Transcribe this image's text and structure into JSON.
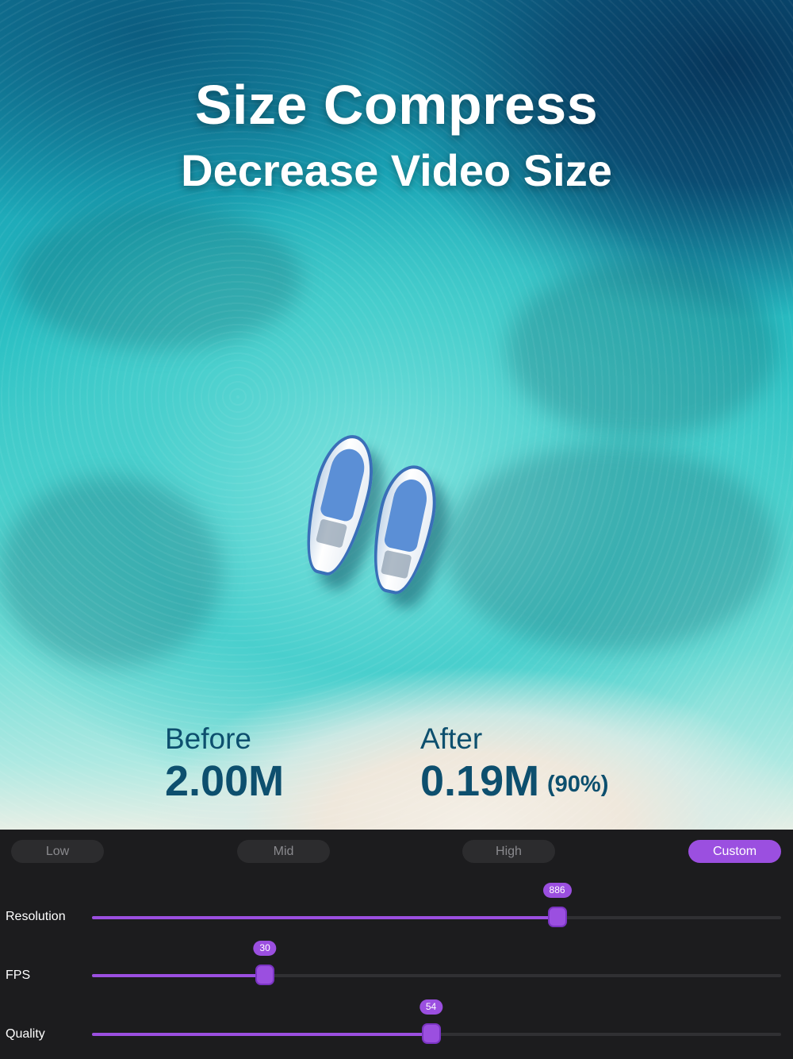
{
  "header": {
    "title": "Size Compress",
    "subtitle": "Decrease Video Size"
  },
  "stats": {
    "before_label": "Before",
    "before_value": "2.00M",
    "after_label": "After",
    "after_value": "0.19M",
    "after_percent": "(90%)"
  },
  "presets": [
    {
      "label": "Low",
      "active": false
    },
    {
      "label": "Mid",
      "active": false
    },
    {
      "label": "High",
      "active": false
    },
    {
      "label": "Custom",
      "active": true
    }
  ],
  "sliders": [
    {
      "label": "Resolution",
      "value": "886",
      "fraction": 0.675
    },
    {
      "label": "FPS",
      "value": "30",
      "fraction": 0.251
    },
    {
      "label": "Quality",
      "value": "54",
      "fraction": 0.492
    }
  ],
  "colors": {
    "accent": "#9b4fe0",
    "panel_bg": "#1c1c1e",
    "preset_bg": "#2c2c2e",
    "stat_text": "#0d4f6e"
  }
}
